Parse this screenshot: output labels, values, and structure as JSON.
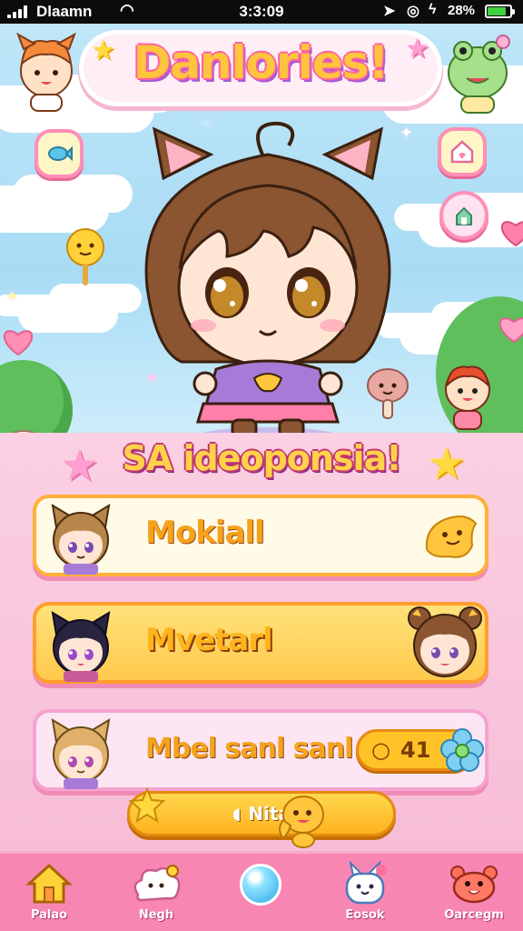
{
  "status_bar": {
    "carrier": "Dlaamn",
    "time": "3:3:09",
    "battery_percent": "28%",
    "battery_level": 0.85,
    "icons": [
      "signal-icon",
      "wifi-icon",
      "location-icon",
      "alarm-icon",
      "charging-icon",
      "battery-icon"
    ]
  },
  "game": {
    "title": "Danlories!"
  },
  "scene": {
    "left_icon": "fish-icon",
    "right_icons": [
      "house-icon",
      "lock-icon"
    ]
  },
  "panel": {
    "header": "SA ideoponsia!"
  },
  "rows": [
    {
      "label": "Mokiall",
      "portrait": "cat-ear-girl-brown",
      "accessory": "slime-icon"
    },
    {
      "label": "Mvetarl",
      "portrait": "cat-ear-girl-black",
      "accessory": "bun-girl-portrait"
    },
    {
      "label": "Mbel sanl sanl",
      "portrait": "cat-ear-girl-blonde",
      "badge_value": "41",
      "accessory": "flower-icon"
    }
  ],
  "action_button": {
    "label": "Nita"
  },
  "nav": {
    "items": [
      {
        "label": "Palao",
        "icon": "house-icon"
      },
      {
        "label": "Negh",
        "icon": "cat-cloud-icon"
      },
      {
        "label": "",
        "icon": "orb-icon"
      },
      {
        "label": "Eosok",
        "icon": "bunny-icon"
      },
      {
        "label": "Oarcegm",
        "icon": "crab-icon"
      }
    ]
  },
  "colors": {
    "accent_pink": "#f787b2",
    "title_yellow": "#ffc53d",
    "row_border": "#ffb03a"
  }
}
